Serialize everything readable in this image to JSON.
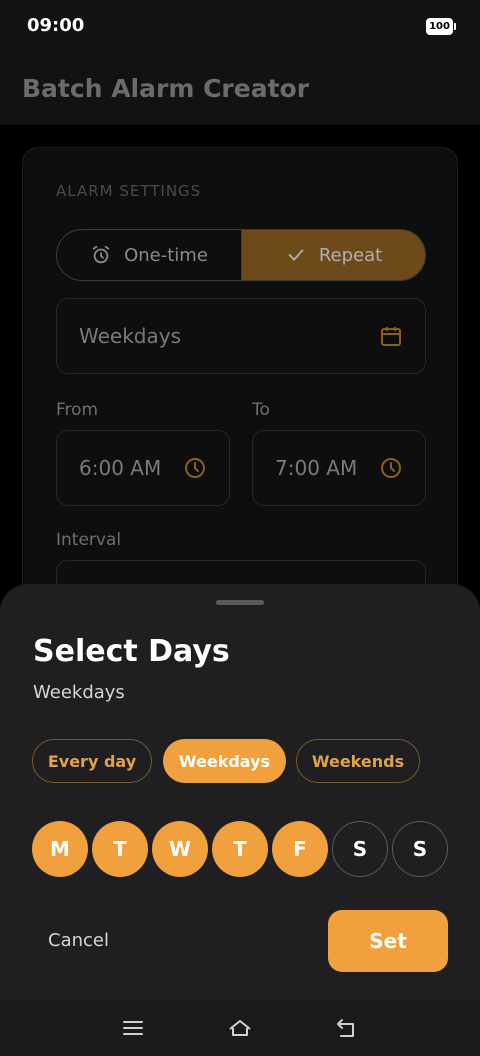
{
  "status_bar": {
    "time": "09:00",
    "battery": "100"
  },
  "app_bar": {
    "title": "Batch Alarm Creator"
  },
  "settings": {
    "section_label": "ALARM SETTINGS",
    "mode_toggle": {
      "one_time_label": "One-time",
      "repeat_label": "Repeat",
      "selected": "Repeat"
    },
    "days_field_value": "Weekdays",
    "from_label": "From",
    "from_value": "6:00 AM",
    "to_label": "To",
    "to_value": "7:00 AM",
    "interval_label": "Interval"
  },
  "sheet": {
    "title": "Select Days",
    "subtitle": "Weekdays",
    "presets": [
      {
        "label": "Every day",
        "selected": false
      },
      {
        "label": "Weekdays",
        "selected": true
      },
      {
        "label": "Weekends",
        "selected": false
      }
    ],
    "days": [
      {
        "label": "M",
        "selected": true
      },
      {
        "label": "T",
        "selected": true
      },
      {
        "label": "W",
        "selected": true
      },
      {
        "label": "T",
        "selected": true
      },
      {
        "label": "F",
        "selected": true
      },
      {
        "label": "S",
        "selected": false
      },
      {
        "label": "S",
        "selected": false
      }
    ],
    "cancel_label": "Cancel",
    "set_label": "Set"
  },
  "colors": {
    "accent": "#f0a03c",
    "sheet_bg": "#1f1f21",
    "background": "#000000"
  },
  "icons": {
    "alarm": "alarm-clock-icon",
    "check": "check-icon",
    "calendar": "calendar-icon",
    "clock": "clock-icon",
    "menu": "menu-icon",
    "home": "home-icon",
    "back": "back-icon"
  }
}
